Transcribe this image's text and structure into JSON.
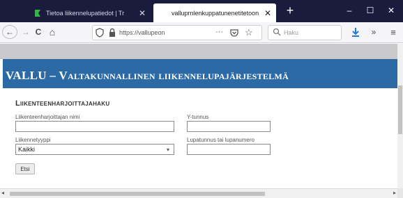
{
  "browser": {
    "tabs": [
      {
        "title": "Tietoa liikennelupatiedot | Tr",
        "active": false,
        "close_label": "✕"
      },
      {
        "title": "valluprnlenkuppatunenetitetoon",
        "active": true,
        "close_label": "✕"
      }
    ],
    "new_tab_label": "+",
    "window_controls": {
      "minimize": "–",
      "maximize": "☐",
      "close": "✕"
    },
    "nav": {
      "back": "←",
      "forward": "→",
      "reload": "C",
      "home": "⌂",
      "url": "https://vallupeon",
      "more": "···",
      "star": "☆",
      "search_placeholder": "Haku",
      "overflow": "»",
      "menu": "≡"
    },
    "colors": {
      "tabbar": "#1a1c3e",
      "banner": "#2b6aa5",
      "download": "#1f7ad6"
    }
  },
  "page": {
    "banner_title": "VALLU – Valtakunnallinen liikennelupajärjestelmä",
    "section_title": "Liikenteenharjoittajahaku",
    "fields": {
      "name_label": "Liikenteenharjoittajan nimi",
      "ytunnus_label": "Y-tunnus",
      "type_label": "Liikennetyyppi",
      "type_value": "Kaikki",
      "permit_label": "Lupatunnus tai lupanumero"
    },
    "search_button": "Etsi"
  },
  "scrollbars": {
    "left_arrow": "◂",
    "right_arrow": "▸"
  }
}
